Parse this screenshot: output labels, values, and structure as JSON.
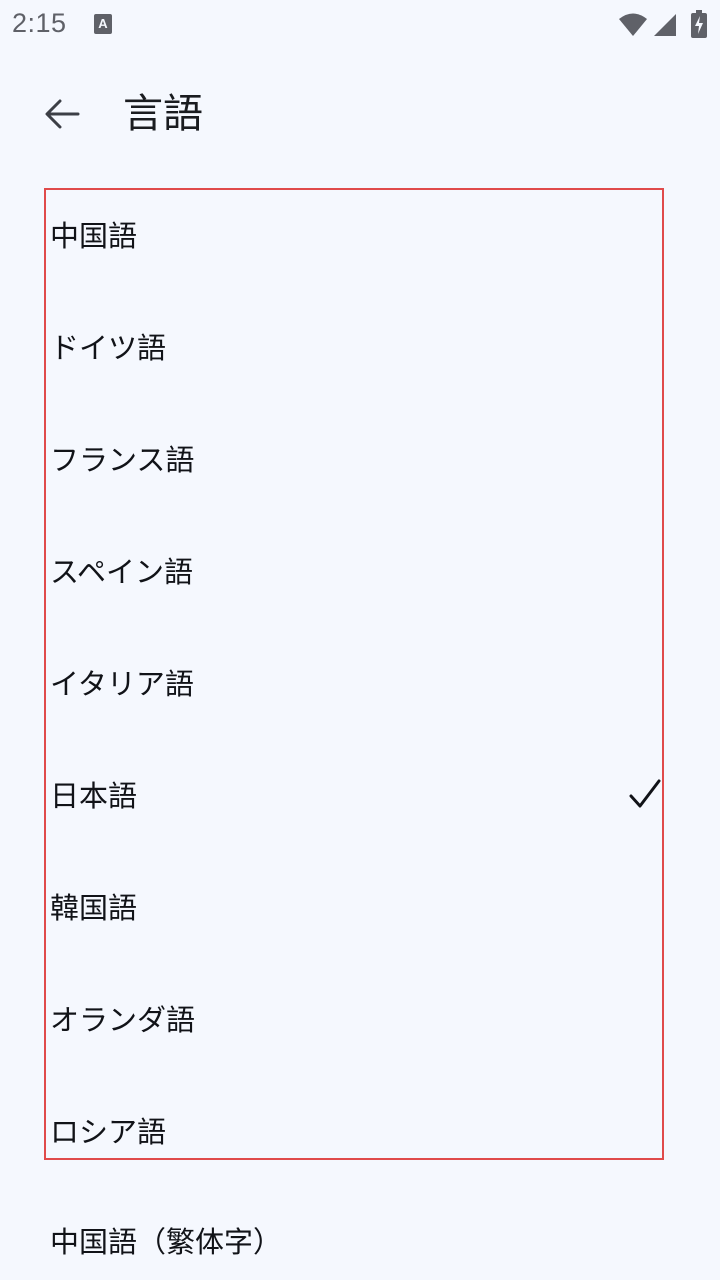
{
  "status_bar": {
    "time": "2:15",
    "notification_icon": "keyboard-a-icon",
    "icons": [
      "wifi-icon",
      "cellular-signal-icon",
      "battery-charging-icon"
    ]
  },
  "app_bar": {
    "back_icon": "arrow-back-icon",
    "title": "言語"
  },
  "languages": [
    {
      "label": "中国語",
      "selected": false
    },
    {
      "label": "ドイツ語",
      "selected": false
    },
    {
      "label": "フランス語",
      "selected": false
    },
    {
      "label": "スペイン語",
      "selected": false
    },
    {
      "label": "イタリア語",
      "selected": false
    },
    {
      "label": "日本語",
      "selected": true
    },
    {
      "label": "韓国語",
      "selected": false
    },
    {
      "label": "オランダ語",
      "selected": false
    },
    {
      "label": "ロシア語",
      "selected": false
    },
    {
      "label": "中国語（繁体字）",
      "selected": false
    }
  ],
  "colors": {
    "background": "#f5f8fe",
    "highlight_border": "#e04b4b",
    "text": "#111318"
  }
}
